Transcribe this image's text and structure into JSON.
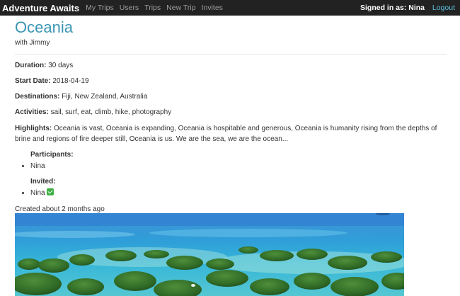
{
  "navbar": {
    "brand": "Adventure Awaits",
    "links": [
      "My Trips",
      "Users",
      "Trips",
      "New Trip",
      "Invites"
    ],
    "signed_in": "Signed in as: Nina",
    "logout": "Logout"
  },
  "trip": {
    "title": "Oceania",
    "with": "with Jimmy",
    "duration_label": "Duration:",
    "duration": "30 days",
    "start_label": "Start Date:",
    "start": "2018-04-19",
    "destinations_label": "Destinations:",
    "destinations": "Fiji, New Zealand, Australia",
    "activities_label": "Activities:",
    "activities": "sail, surf, eat, climb, hike, photography",
    "highlights_label": "Highlights:",
    "highlights": "Oceania is vast, Oceania is expanding, Oceania is hospitable and generous, Oceania is humanity rising from the depths of brine and regions of fire deeper still, Oceania is us. We are the sea, we are the ocean...",
    "participants_label": "Participants:",
    "participants": [
      "Nina"
    ],
    "invited_label": "Invited:",
    "invited": [
      "Nina"
    ],
    "created": "Created about 2 months ago"
  },
  "colors": {
    "navbar_bg": "#222222",
    "title": "#3a95b3",
    "logout": "#5bc0de",
    "check": "#3cb043"
  }
}
